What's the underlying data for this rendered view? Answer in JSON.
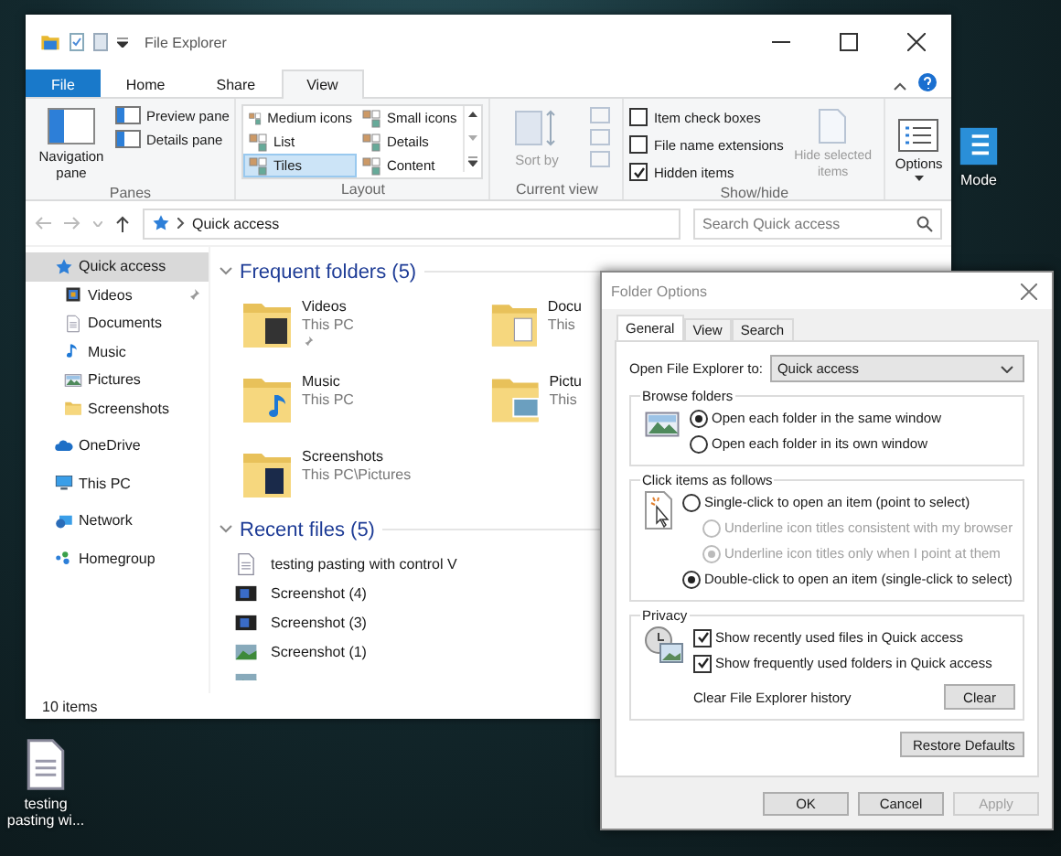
{
  "desktop_icons": [
    {
      "label": "Mode"
    },
    {
      "label": "testing pasting wi..."
    }
  ],
  "explorer": {
    "title": "File Explorer",
    "ribbon_tabs": [
      {
        "label": "File",
        "selected": false
      },
      {
        "label": "Home",
        "selected": false
      },
      {
        "label": "Share",
        "selected": false
      },
      {
        "label": "View",
        "selected": true
      }
    ],
    "panes": {
      "label": "Panes",
      "navigation_pane": "Navigation pane",
      "items": [
        "Preview pane",
        "Details pane"
      ]
    },
    "layout": {
      "label": "Layout",
      "options": [
        {
          "label": "Medium icons",
          "selected": false
        },
        {
          "label": "Small icons",
          "selected": false
        },
        {
          "label": "List",
          "selected": false
        },
        {
          "label": "Details",
          "selected": false
        },
        {
          "label": "Tiles",
          "selected": true
        },
        {
          "label": "Content",
          "selected": false
        }
      ]
    },
    "current_view": {
      "label": "Current view",
      "sort": "Sort by"
    },
    "show_hide": {
      "label": "Show/hide",
      "checkboxes": [
        {
          "label": "Item check boxes",
          "checked": false
        },
        {
          "label": "File name extensions",
          "checked": false
        },
        {
          "label": "Hidden items",
          "checked": true
        }
      ],
      "hide_selected": "Hide selected items"
    },
    "options": "Options",
    "address": "Quick access",
    "search": {
      "placeholder": "Search Quick access"
    },
    "sidebar": [
      {
        "label": "Quick access",
        "selected": true,
        "children": [
          {
            "label": "Videos",
            "selected": false,
            "pinned": true
          },
          {
            "label": "Documents",
            "selected": false,
            "pinned": false
          },
          {
            "label": "Music",
            "selected": false,
            "pinned": false
          },
          {
            "label": "Pictures",
            "selected": false,
            "pinned": false
          },
          {
            "label": "Screenshots",
            "selected": false,
            "pinned": false
          }
        ]
      },
      {
        "label": "OneDrive",
        "selected": false
      },
      {
        "label": "This PC",
        "selected": false
      },
      {
        "label": "Network",
        "selected": false
      },
      {
        "label": "Homegroup",
        "selected": false
      }
    ],
    "frequent": {
      "heading": "Frequent folders (5)",
      "folders": [
        {
          "name": "Videos",
          "location": "This PC",
          "pinned": true
        },
        {
          "name": "Docu",
          "location": "This",
          "pinned": false
        },
        {
          "name": "Music",
          "location": "This PC",
          "pinned": false
        },
        {
          "name": "Pictu",
          "location": "This",
          "pinned": false
        },
        {
          "name": "Screenshots",
          "location": "This PC\\Pictures",
          "pinned": false
        }
      ]
    },
    "recent": {
      "heading": "Recent files (5)",
      "files": [
        "testing pasting with control V",
        "Screenshot (4)",
        "Screenshot (3)",
        "Screenshot (1)"
      ]
    },
    "status": "10 items"
  },
  "folder_options": {
    "title": "Folder Options",
    "tabs": [
      {
        "label": "General",
        "selected": true
      },
      {
        "label": "View",
        "selected": false
      },
      {
        "label": "Search",
        "selected": false
      }
    ],
    "open_to": {
      "label": "Open File Explorer to:",
      "value": "Quick access"
    },
    "browse": {
      "legend": "Browse folders",
      "options": [
        {
          "label": "Open each folder in the same window",
          "selected": true
        },
        {
          "label": "Open each folder in its own window",
          "selected": false
        }
      ]
    },
    "click": {
      "legend": "Click items as follows",
      "options": [
        {
          "label": "Single-click to open an item (point to select)",
          "selected": false,
          "disabled": false,
          "sub": false
        },
        {
          "label": "Underline icon titles consistent with my browser",
          "selected": false,
          "disabled": true,
          "sub": true
        },
        {
          "label": "Underline icon titles only when I point at them",
          "selected": true,
          "disabled": true,
          "sub": true
        },
        {
          "label": "Double-click to open an item (single-click to select)",
          "selected": true,
          "disabled": false,
          "sub": false
        }
      ]
    },
    "privacy": {
      "legend": "Privacy",
      "checkboxes": [
        {
          "label": "Show recently used files in Quick access",
          "checked": true
        },
        {
          "label": "Show frequently used folders in Quick access",
          "checked": true
        }
      ],
      "clear_label": "Clear File Explorer history",
      "clear_button": "Clear"
    },
    "restore": "Restore Defaults",
    "buttons": [
      {
        "label": "OK",
        "disabled": false
      },
      {
        "label": "Cancel",
        "disabled": false
      },
      {
        "label": "Apply",
        "disabled": true
      }
    ]
  }
}
